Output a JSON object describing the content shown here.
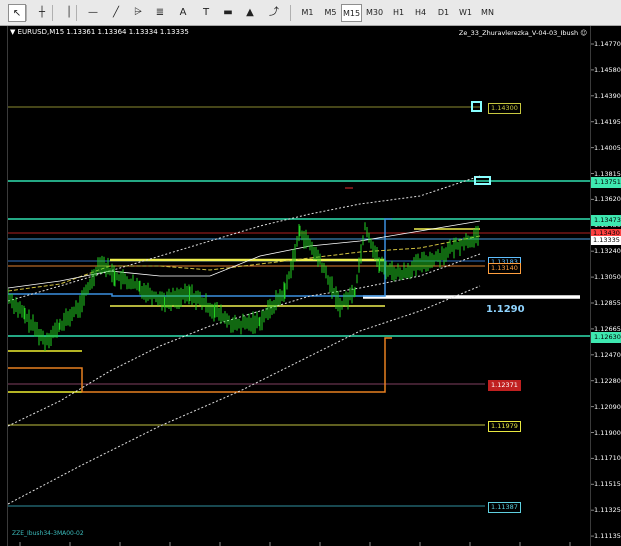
{
  "toolbar": {
    "tools": [
      {
        "name": "cursor-icon",
        "glyph": "↖"
      },
      {
        "name": "crosshair-icon",
        "glyph": "┼"
      },
      {
        "name": "vertical-line-icon",
        "glyph": "│"
      },
      {
        "name": "horizontal-line-icon",
        "glyph": "—"
      },
      {
        "name": "trendline-icon",
        "glyph": "╱"
      },
      {
        "name": "channel-icon",
        "glyph": "⩥"
      },
      {
        "name": "fibonacci-icon",
        "glyph": "≣"
      },
      {
        "name": "text-icon",
        "glyph": "A"
      },
      {
        "name": "text-label-icon",
        "glyph": "T"
      },
      {
        "name": "rectangle-icon",
        "glyph": "▬"
      },
      {
        "name": "triangle-icon",
        "glyph": "▲"
      },
      {
        "name": "arrows-icon",
        "glyph": "⤴"
      }
    ],
    "timeframes": [
      "M1",
      "M5",
      "M15",
      "M30",
      "H1",
      "H4",
      "D1",
      "W1",
      "MN"
    ],
    "active_timeframe": "M15"
  },
  "chart": {
    "symbol_info": "▼ EURUSD,M15  1.13361 1.13364 1.13334 1.13335",
    "indicator_name": "Ze_33_Zhuravlerezka_V-04-03_Ibush ☺",
    "footer_note": "ZZE_Ibush34-3MA00-02",
    "big_level_label": "1.1290",
    "price_ticks": [
      "1.14770",
      "1.14580",
      "1.14390",
      "1.14195",
      "1.14005",
      "1.13815",
      "1.13620",
      "1.13430",
      "1.13240",
      "1.13050",
      "1.12855",
      "1.12665",
      "1.12470",
      "1.12280",
      "1.12090",
      "1.11900",
      "1.11710",
      "1.11515",
      "1.11325",
      "1.11135"
    ],
    "level_labels": [
      {
        "text": "1.14300",
        "color": "#c8c840",
        "bg": "#000"
      },
      {
        "text": "1.13751",
        "color": "#000",
        "bg": "#3ee8b0"
      },
      {
        "text": "1.13473",
        "color": "#000",
        "bg": "#3ee8b0"
      },
      {
        "text": "1.13183",
        "color": "#5fbfff",
        "bg": "#000"
      },
      {
        "text": "1.13140",
        "color": "#ffa040",
        "bg": "#000"
      },
      {
        "text": "1.12630",
        "color": "#000",
        "bg": "#3ee8b0"
      },
      {
        "text": "1.12371",
        "color": "#fff",
        "bg": "#c02020"
      },
      {
        "text": "1.11979",
        "color": "#e8e840",
        "bg": "#000"
      },
      {
        "text": "1.11387",
        "color": "#5fd0e0",
        "bg": "#000"
      }
    ],
    "price_tags": [
      {
        "text": "1.13430",
        "color": "#000",
        "bg": "#ff4040"
      },
      {
        "text": "1.13335",
        "color": "#000",
        "bg": "#ffffff"
      }
    ]
  }
}
